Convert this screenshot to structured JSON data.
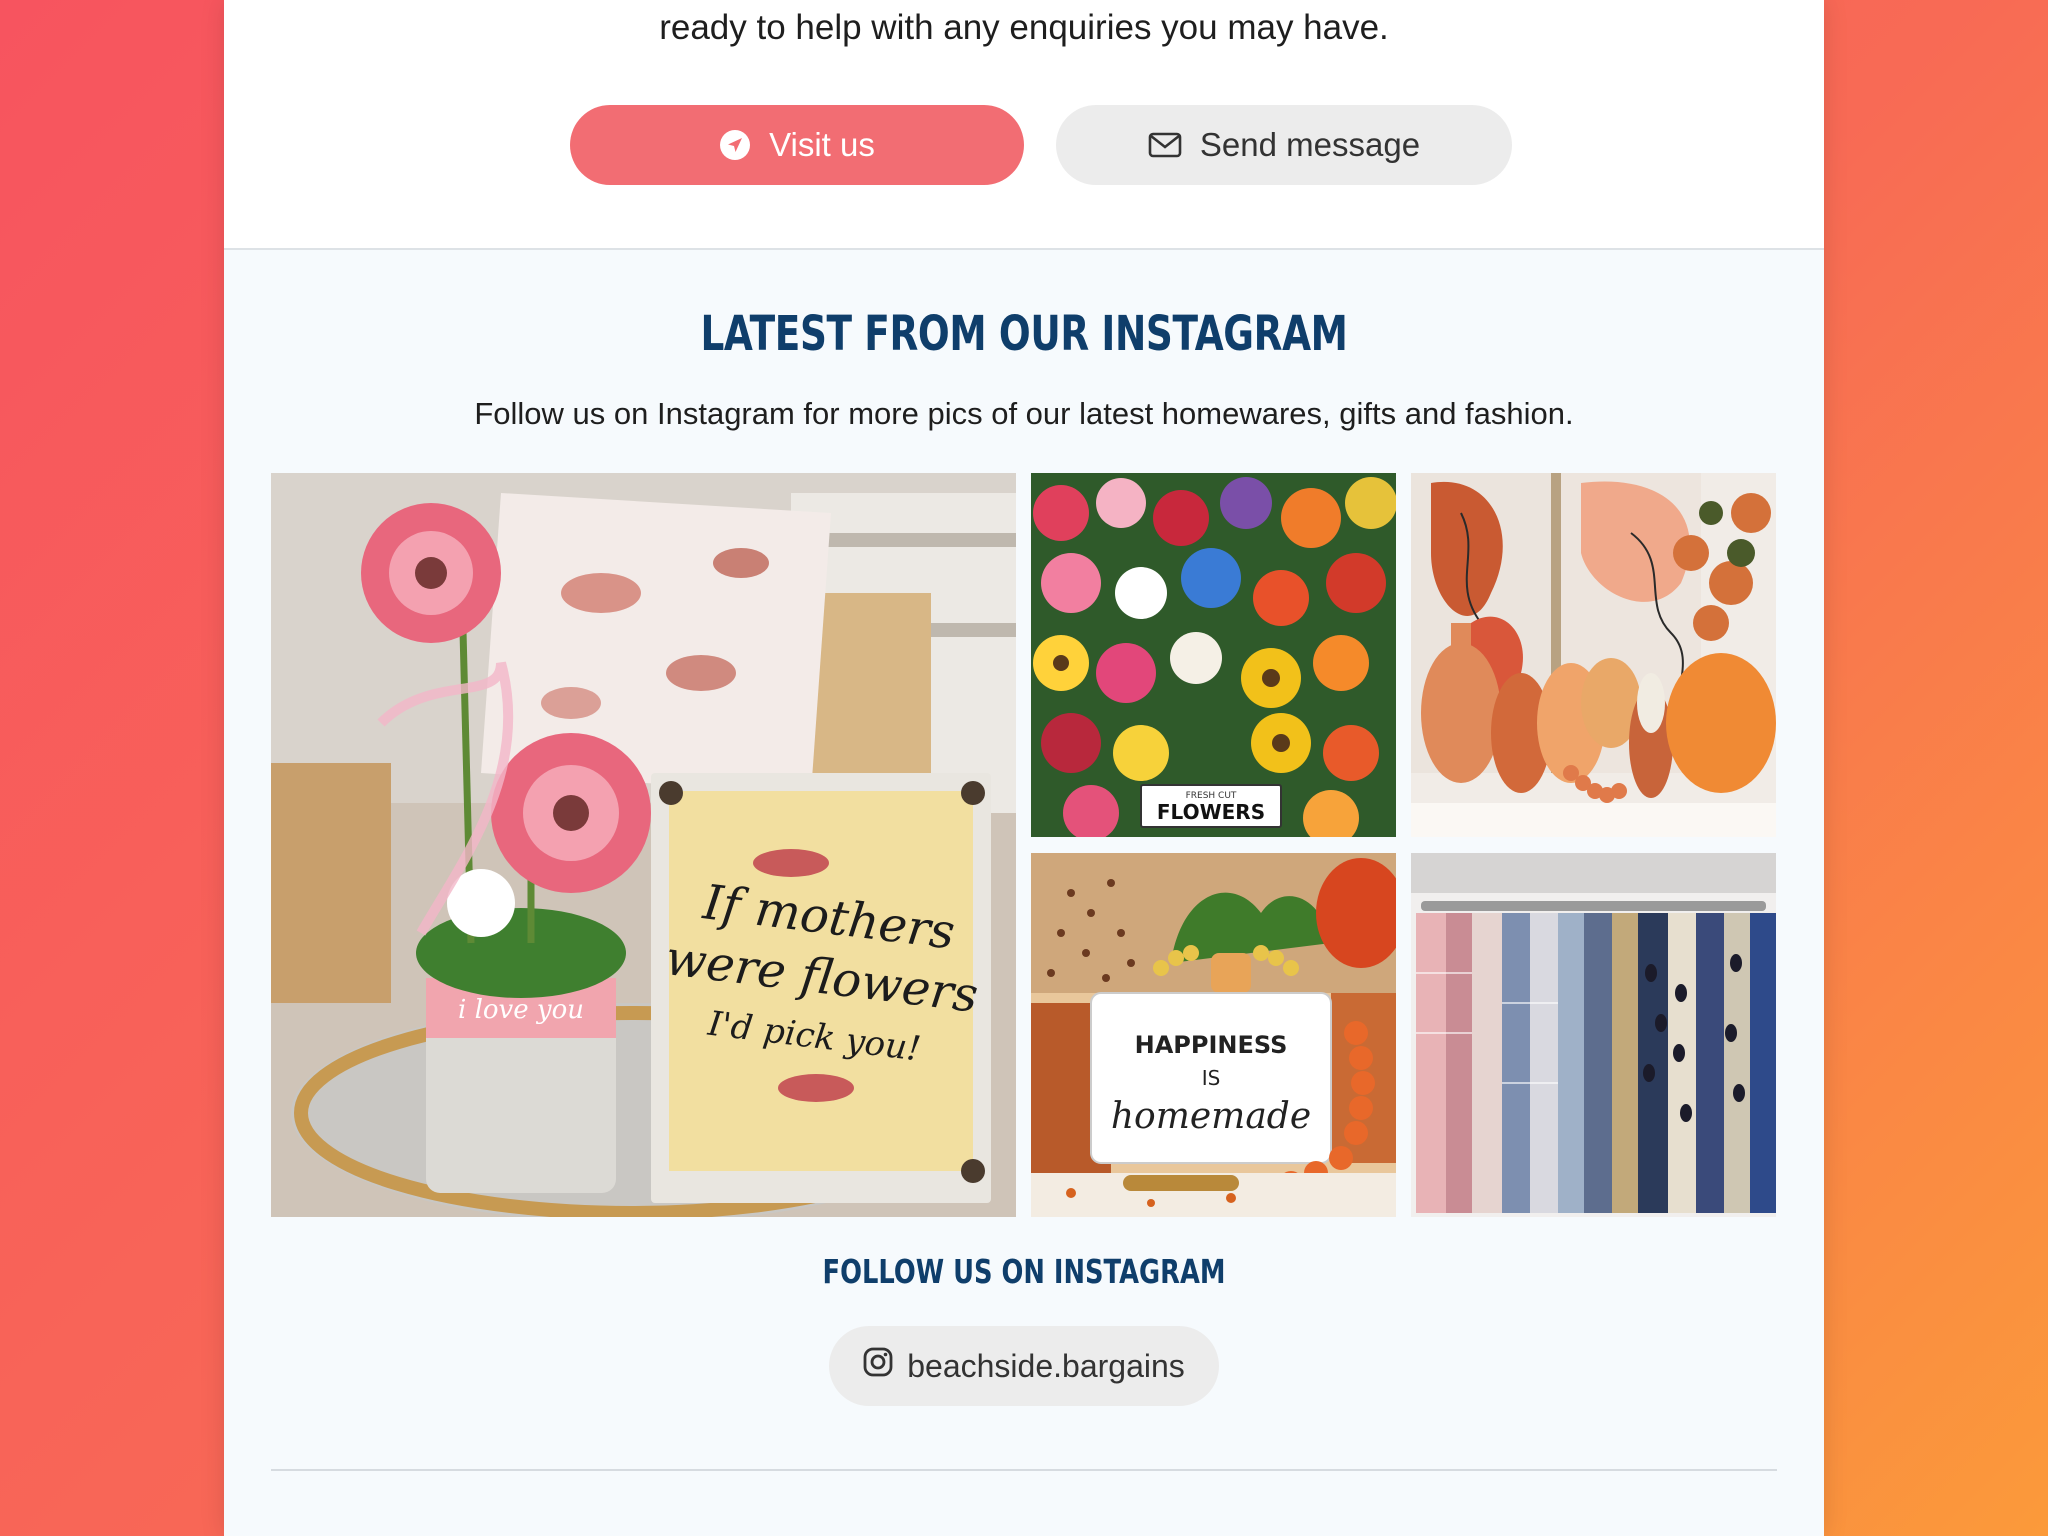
{
  "contact": {
    "intro_text": "ready to help with any enquiries you may have.",
    "visit_button_label": "Visit us",
    "message_button_label": "Send message",
    "visit_icon": "navigation-arrow-icon",
    "message_icon": "envelope-icon"
  },
  "instagram": {
    "title": "LATEST FROM OUR INSTAGRAM",
    "subtitle": "Follow us on Instagram for more pics of our latest homewares, gifts and fashion.",
    "photos": [
      {
        "sign_lines": [
          "If mothers",
          "were flowers",
          "I'd pick you!"
        ],
        "pot_text": "i love you"
      },
      {
        "sign_small": "FRESH CUT",
        "sign_main": "FLOWERS"
      },
      {},
      {
        "sign_lines": [
          "HAPPINESS",
          "IS",
          "homemade"
        ]
      },
      {}
    ],
    "follow_heading": "FOLLOW US ON INSTAGRAM",
    "handle": "beachside.bargains",
    "handle_icon": "instagram-icon"
  },
  "colors": {
    "accent": "#f26d73",
    "heading": "#0f3e6b",
    "background_gradient_start": "#f7545f",
    "background_gradient_end": "#fb9a3a"
  }
}
